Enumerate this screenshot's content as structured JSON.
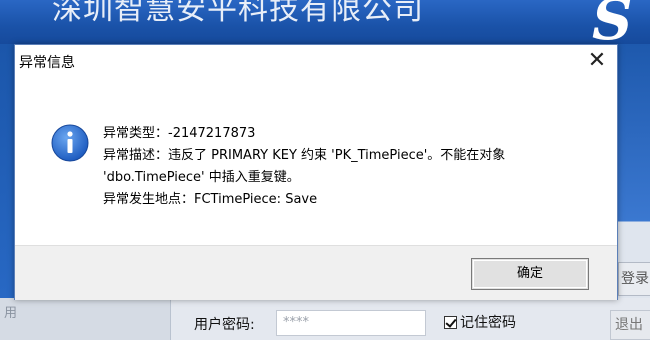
{
  "background": {
    "company_name": "深圳智慧安平科技有限公司",
    "logo_text": "S",
    "left_panel_text": "用",
    "password_label": "用户密码:",
    "password_value": "****",
    "remember_label": "记住密码",
    "remember_checked": true,
    "login_button": "登录",
    "exit_button": "退出"
  },
  "dialog": {
    "title": "异常信息",
    "close_symbol": "✕",
    "icon": "info-icon",
    "message_lines": [
      "异常类型：-2147217873",
      "异常描述：违反了 PRIMARY KEY 约束 'PK_TimePiece'。不能在对象",
      "'dbo.TimePiece' 中插入重复键。",
      "异常发生地点：FCTimePiece: Save"
    ],
    "ok_button": "确定"
  },
  "colors": {
    "background_blue": "#1a4fa0",
    "dialog_border": "#5b7fb8",
    "info_icon_blue": "#2f6fd0"
  }
}
